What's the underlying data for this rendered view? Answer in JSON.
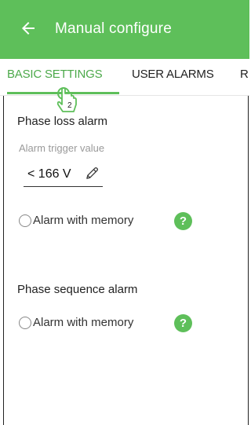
{
  "appbar": {
    "title": "Manual configure",
    "back_icon": "arrow-left-icon"
  },
  "tabs": [
    {
      "label": "BASIC SETTINGS",
      "active": true
    },
    {
      "label": "USER ALARMS",
      "active": false
    },
    {
      "label": "R",
      "active": false
    }
  ],
  "pointer": {
    "icon": "hand-pointer-icon",
    "badge": "2"
  },
  "phase_loss": {
    "title": "Phase loss alarm",
    "field_label": "Alarm trigger value",
    "field_value": "< 166 V",
    "edit_icon": "pencil-icon",
    "radio_label": "Alarm with memory",
    "help_icon": "?"
  },
  "phase_sequence": {
    "title": "Phase sequence alarm",
    "radio_label": "Alarm with memory",
    "help_icon": "?"
  },
  "colors": {
    "accent": "#5ebf5a",
    "tab_active_text": "#4ca94a"
  }
}
